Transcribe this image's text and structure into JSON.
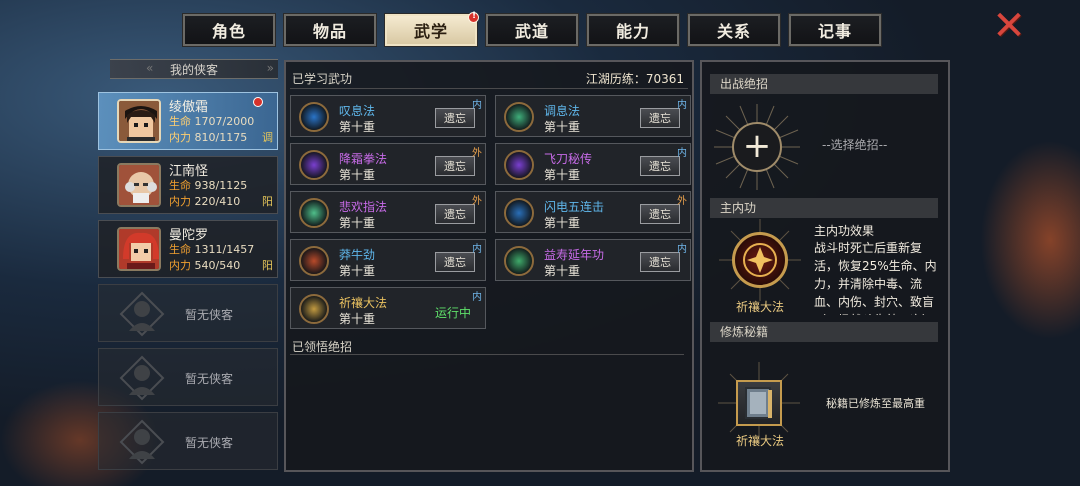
{
  "tabs": [
    {
      "label": "角色"
    },
    {
      "label": "物品"
    },
    {
      "label": "武学"
    },
    {
      "label": "武道"
    },
    {
      "label": "能力"
    },
    {
      "label": "关系"
    },
    {
      "label": "记事"
    }
  ],
  "active_tab": "武学",
  "my_heroes_title": "我的侠客",
  "heroes": [
    {
      "name": "绫傲霜",
      "hp_label": "生命",
      "hp": "1707/2000",
      "mp_label": "内力",
      "mp": "810/1175",
      "tag": "调"
    },
    {
      "name": "江南怪",
      "hp_label": "生命",
      "hp": "938/1125",
      "mp_label": "内力",
      "mp": "220/410",
      "tag": "阳"
    },
    {
      "name": "曼陀罗",
      "hp_label": "生命",
      "hp": "1311/1457",
      "mp_label": "内力",
      "mp": "540/540",
      "tag": "阳"
    }
  ],
  "empty_slot_text": "暂无侠客",
  "learned_section": {
    "title": "已学习武功",
    "exp_label": "江湖历练：70361"
  },
  "skills": [
    {
      "name": "叹息法",
      "level": "第十重",
      "button": "遗忘",
      "type": "内",
      "color": "#5fb6ea",
      "icon_color": "#2a74c8"
    },
    {
      "name": "调息法",
      "level": "第十重",
      "button": "遗忘",
      "type": "内",
      "color": "#5fb6ea",
      "icon_color": "#3fae7a"
    },
    {
      "name": "降霜拳法",
      "level": "第十重",
      "button": "遗忘",
      "type": "外",
      "color": "#c86be8",
      "icon_color": "#7a3fd0"
    },
    {
      "name": "飞刀秘传",
      "level": "第十重",
      "button": "遗忘",
      "type": "内",
      "color": "#c86be8",
      "icon_color": "#7a3fd0"
    },
    {
      "name": "悲欢指法",
      "level": "第十重",
      "button": "遗忘",
      "type": "外",
      "color": "#c86be8",
      "icon_color": "#4fbf8a"
    },
    {
      "name": "闪电五连击",
      "level": "第十重",
      "button": "遗忘",
      "type": "外",
      "color": "#5fb6ea",
      "icon_color": "#2a6fb8"
    },
    {
      "name": "莽牛劲",
      "level": "第十重",
      "button": "遗忘",
      "type": "内",
      "color": "#5fb6ea",
      "icon_color": "#b84a2a"
    },
    {
      "name": "益寿延年功",
      "level": "第十重",
      "button": "遗忘",
      "type": "内",
      "color": "#c86be8",
      "icon_color": "#3faa6a"
    },
    {
      "name": "祈禳大法",
      "level": "第十重",
      "button": "运行中",
      "type": "内",
      "color": "#e8c060",
      "icon_color": "#c29a40"
    }
  ],
  "comprehended_title": "已领悟绝招",
  "right": {
    "battle_title": "出战绝招",
    "plus": "+",
    "choose_text": "--选择绝招--",
    "inner_title": "主内功",
    "inner_name": "祈禳大法",
    "effect_title": "主内功效果",
    "effect_text": "战斗时死亡后重新复活，恢复25%生命、内力，并清除中毒、流血、内伤、封穴、致盲（一场战斗生效一次）",
    "book_title": "修炼秘籍",
    "book_name": "祈禳大法",
    "book_status": "秘籍已修炼至最高重"
  },
  "close_icon": "close-x-icon"
}
